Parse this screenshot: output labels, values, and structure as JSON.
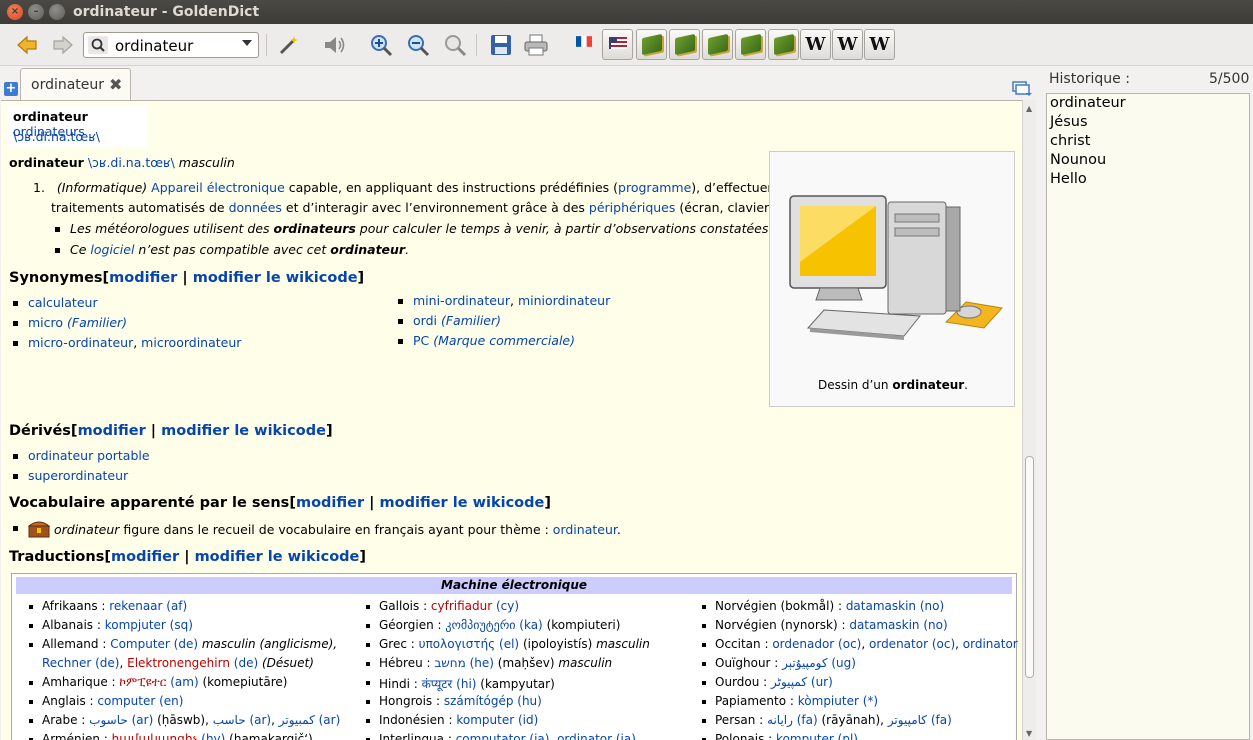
{
  "window": {
    "title": "ordinateur - GoldenDict"
  },
  "toolbar": {
    "search_value": "ordinateur",
    "icons": [
      "back-arrow-icon",
      "forward-arrow-icon",
      "search-icon",
      "wand-icon",
      "speaker-icon",
      "zoom-in-icon",
      "zoom-out-icon",
      "zoom-reset-icon",
      "save-icon",
      "print-icon",
      "french-flag-icon",
      "us-flag-icon"
    ],
    "dicts": [
      "book",
      "book",
      "book",
      "book",
      "book",
      "W",
      "W",
      "W"
    ]
  },
  "tab": {
    "label": "ordinateur"
  },
  "article": {
    "header_word": "ordinateur",
    "header_plural": "ordinateurs",
    "header_pron": "\\ɔʁ.di.na.tœʁ\\",
    "entry_word": "ordinateur",
    "entry_pron": "\\ɔʁ.di.na.tœʁ\\",
    "entry_gender": "masculin",
    "def_num": "1.",
    "def_domain": "(Informatique)",
    "def_l1": "Appareil électronique",
    "def_t1": " capable, en appliquant des instructions prédéfinies (",
    "def_l2": "programme",
    "def_t2": "), d’effectuer des",
    "def_t3": "traitements automatisés de ",
    "def_l3": "données",
    "def_t4": " et d’interagir avec l’environnement grâce à des ",
    "def_l4": "périphériques",
    "def_t5": " (écran, clavier…).",
    "ex1_a": "Les météorologues utilisent des ",
    "ex1_b": "ordinateurs",
    "ex1_c": " pour calculer le temps à venir, à partir d’observations constatées.",
    "ex2_a": "Ce ",
    "ex2_l": "logiciel",
    "ex2_b": " n’est pas compatible avec cet ",
    "ex2_c": "ordinateur",
    "ex2_d": ".",
    "modifier": "modifier",
    "pipe": " | ",
    "modifier_wikicode": "modifier le wikicode",
    "open": "[",
    "close": "]",
    "syn_title": "Synonymes",
    "syn_calc": "calculateur",
    "syn_micro": "micro",
    "syn_familier": "(Familier)",
    "syn_microord": "micro-ordinateur",
    "syn_microord2": "microordinateur",
    "syn_mini": "mini-ordinateur",
    "syn_mini2": "miniordinateur",
    "syn_ordi": "ordi",
    "syn_pc": "PC",
    "syn_marque": "(Marque commerciale)",
    "comma": ", ",
    "image_caption_a": "Dessin d’un ",
    "image_caption_b": "ordinateur",
    "image_caption_c": ".",
    "der_title": "Dérivés",
    "der_1": "ordinateur portable",
    "der_2": "superordinateur",
    "voc_title": "Vocabulaire apparenté par le sens",
    "voc_word": "ordinateur",
    "voc_text": " figure dans le recueil de vocabulaire en français ayant pour thème : ",
    "voc_link": "ordinateur",
    "voc_end": ".",
    "trad_title": "Traductions",
    "table_header": "Machine électronique"
  },
  "translations": {
    "col1": [
      [
        [
          "t",
          "Afrikaans : "
        ],
        [
          "l",
          "rekenaar (af)"
        ]
      ],
      [
        [
          "t",
          "Albanais : "
        ],
        [
          "l",
          "kompjuter (sq)"
        ]
      ],
      [
        [
          "t",
          "Allemand : "
        ],
        [
          "l",
          "Computer (de)"
        ],
        [
          "i",
          " masculin (anglicisme),"
        ]
      ],
      [
        [
          "l",
          "Rechner (de)"
        ],
        [
          "t",
          ", "
        ],
        [
          "r",
          "Elektronengehirn"
        ],
        [
          "l",
          " (de)"
        ],
        [
          "t",
          " "
        ],
        [
          "i",
          "(Désuet)"
        ]
      ],
      [
        [
          "t",
          "Amharique : "
        ],
        [
          "r",
          "ኮምፒዩተር"
        ],
        [
          "l",
          " (am)"
        ],
        [
          "t",
          " (komepiutāre)"
        ]
      ],
      [
        [
          "t",
          "Anglais : "
        ],
        [
          "l",
          "computer (en)"
        ]
      ],
      [
        [
          "t",
          "Arabe : "
        ],
        [
          "l",
          "حاسوب (ar)"
        ],
        [
          "t",
          " (ḥāswb), "
        ],
        [
          "l",
          "حاسب (ar)"
        ],
        [
          "t",
          ", "
        ],
        [
          "l",
          "كمبيوتر (ar)"
        ]
      ],
      [
        [
          "t",
          "Arménien : "
        ],
        [
          "r",
          "համակարգիչ"
        ],
        [
          "l",
          " (hy)"
        ],
        [
          "t",
          " (hamakargič‘)"
        ]
      ]
    ],
    "col2": [
      [
        [
          "t",
          "Gallois : "
        ],
        [
          "r",
          "cyfrifiadur"
        ],
        [
          "l",
          " (cy)"
        ]
      ],
      [
        [
          "t",
          "Géorgien : "
        ],
        [
          "l",
          "კომპიუტერი (ka)"
        ],
        [
          "t",
          " (kompiuteri)"
        ]
      ],
      [
        [
          "t",
          "Grec : "
        ],
        [
          "l",
          "υπολογιστής (el)"
        ],
        [
          "t",
          " (ipoloyistís) "
        ],
        [
          "i",
          "masculin"
        ]
      ],
      [
        [
          "t",
          "Hébreu : "
        ],
        [
          "l",
          "מחשב (he)"
        ],
        [
          "t",
          " (maḥšev) "
        ],
        [
          "i",
          "masculin"
        ]
      ],
      [
        [
          "t",
          "Hindi : "
        ],
        [
          "l",
          "कंप्यूटर (hi)"
        ],
        [
          "t",
          " (kampyutar)"
        ]
      ],
      [
        [
          "t",
          "Hongrois : "
        ],
        [
          "l",
          "számítógép (hu)"
        ]
      ],
      [
        [
          "t",
          "Indonésien : "
        ],
        [
          "l",
          "komputer (id)"
        ]
      ],
      [
        [
          "t",
          "Interlingua : "
        ],
        [
          "l",
          "computator (ia)"
        ],
        [
          "t",
          ", "
        ],
        [
          "l",
          "ordinator (ia)"
        ]
      ]
    ],
    "col3": [
      [
        [
          "t",
          "Norvégien (bokmål) : "
        ],
        [
          "l",
          "datamaskin (no)"
        ]
      ],
      [
        [
          "t",
          "Norvégien (nynorsk) : "
        ],
        [
          "l",
          "datamaskin (no)"
        ]
      ],
      [
        [
          "t",
          "Occitan : "
        ],
        [
          "l",
          "ordenador (oc)"
        ],
        [
          "t",
          ", "
        ],
        [
          "l",
          "ordenator (oc)"
        ],
        [
          "t",
          ", "
        ],
        [
          "l",
          "ordinator (oc)"
        ]
      ],
      [
        [
          "t",
          "Ouïghour : "
        ],
        [
          "l",
          "كومپيۇتېر (ug)"
        ]
      ],
      [
        [
          "t",
          "Ourdou : "
        ],
        [
          "l",
          "کمپیوٹر (ur)"
        ]
      ],
      [
        [
          "t",
          "Papiamento : "
        ],
        [
          "l",
          "kòmpiuter (*)"
        ]
      ],
      [
        [
          "t",
          "Persan : "
        ],
        [
          "l",
          "رایانه (fa)"
        ],
        [
          "t",
          " (rāyānah), "
        ],
        [
          "l",
          "کامپیوتر (fa)"
        ]
      ],
      [
        [
          "t",
          "Polonais : "
        ],
        [
          "l",
          "komputer (pl)"
        ]
      ]
    ]
  },
  "history": {
    "title": "Historique :",
    "count": "5/500",
    "items": [
      "ordinateur",
      "Jésus",
      "christ",
      "Nounou",
      "Hello"
    ]
  }
}
